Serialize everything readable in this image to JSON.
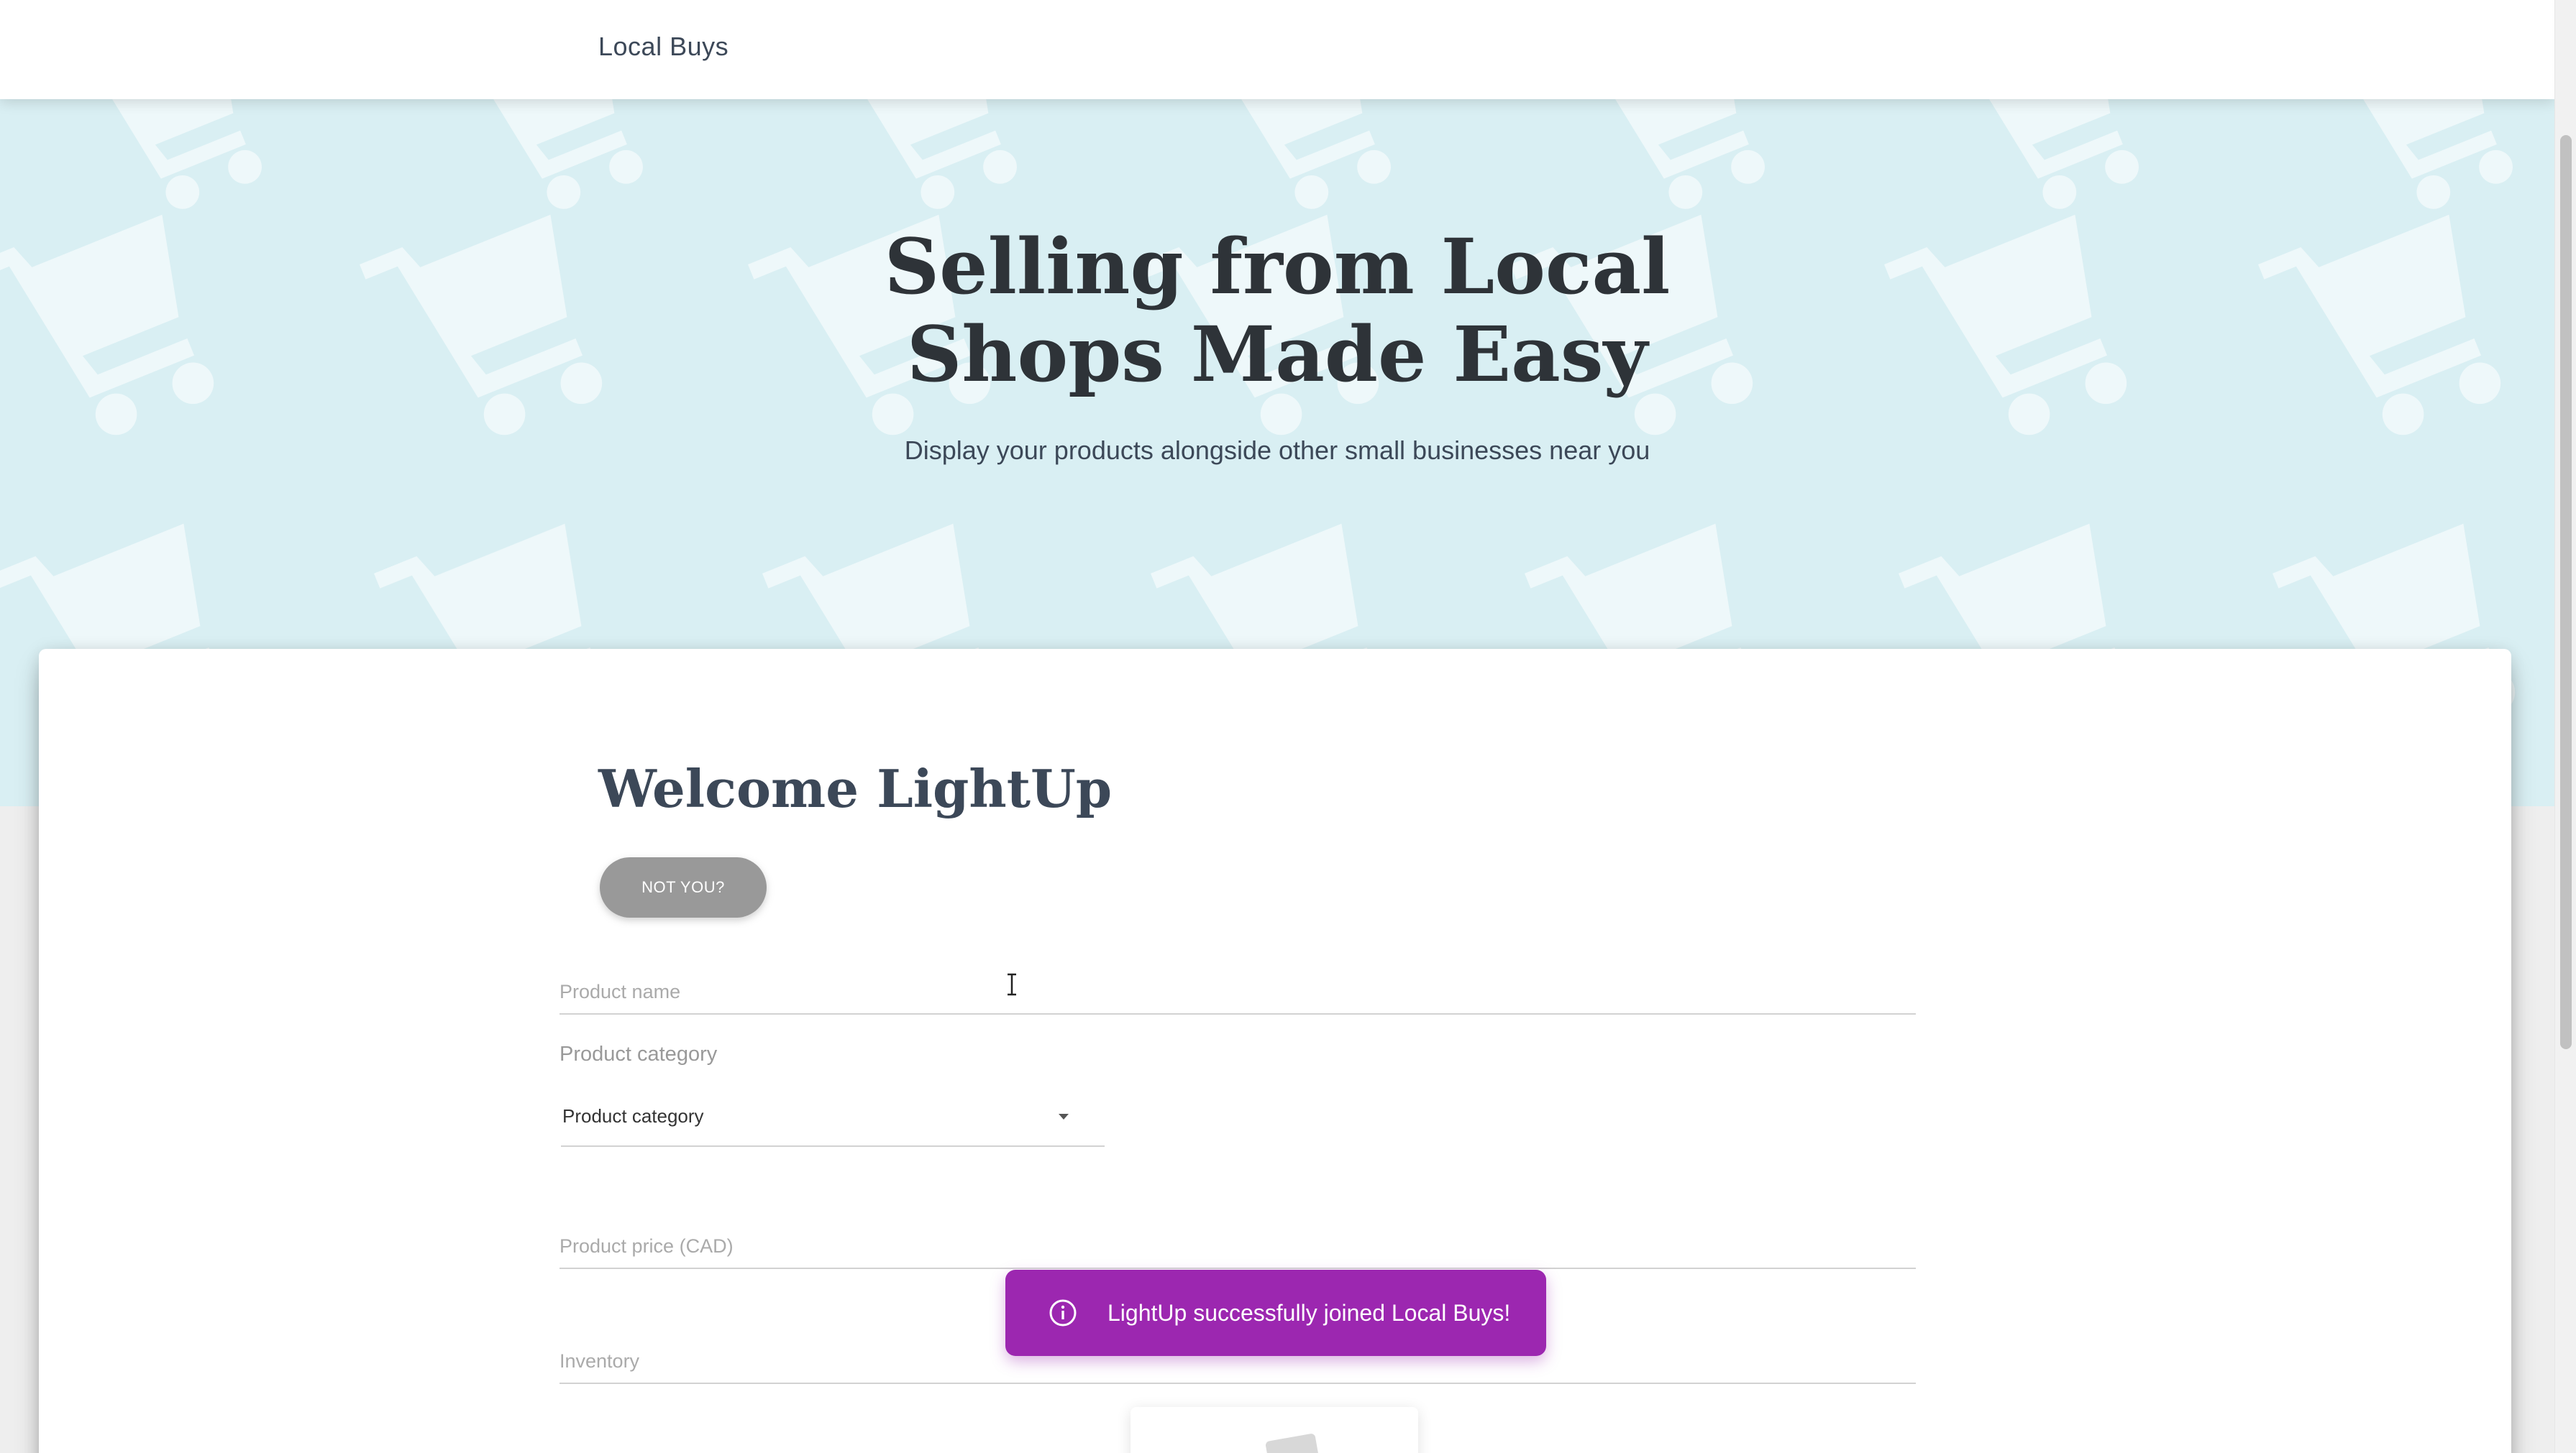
{
  "navbar": {
    "brand": "Local Buys"
  },
  "hero": {
    "title_line1": "Selling from Local",
    "title_line2": "Shops Made Easy",
    "subtitle": "Display your products alongside other small businesses near you"
  },
  "form": {
    "welcome": "Welcome LightUp",
    "not_you_label": "NOT YOU?",
    "product_name_placeholder": "Product name",
    "product_category_label": "Product category",
    "product_category_selected": "Product category",
    "product_price_placeholder": "Product price (CAD)",
    "inventory_placeholder": "Inventory"
  },
  "toast": {
    "icon": "info-icon",
    "message": "LightUp successfully joined Local Buys!",
    "color": "#9c27b0"
  },
  "colors": {
    "hero_bg": "#d9eff3",
    "accent": "#9c27b0",
    "button_gray": "#999999"
  }
}
